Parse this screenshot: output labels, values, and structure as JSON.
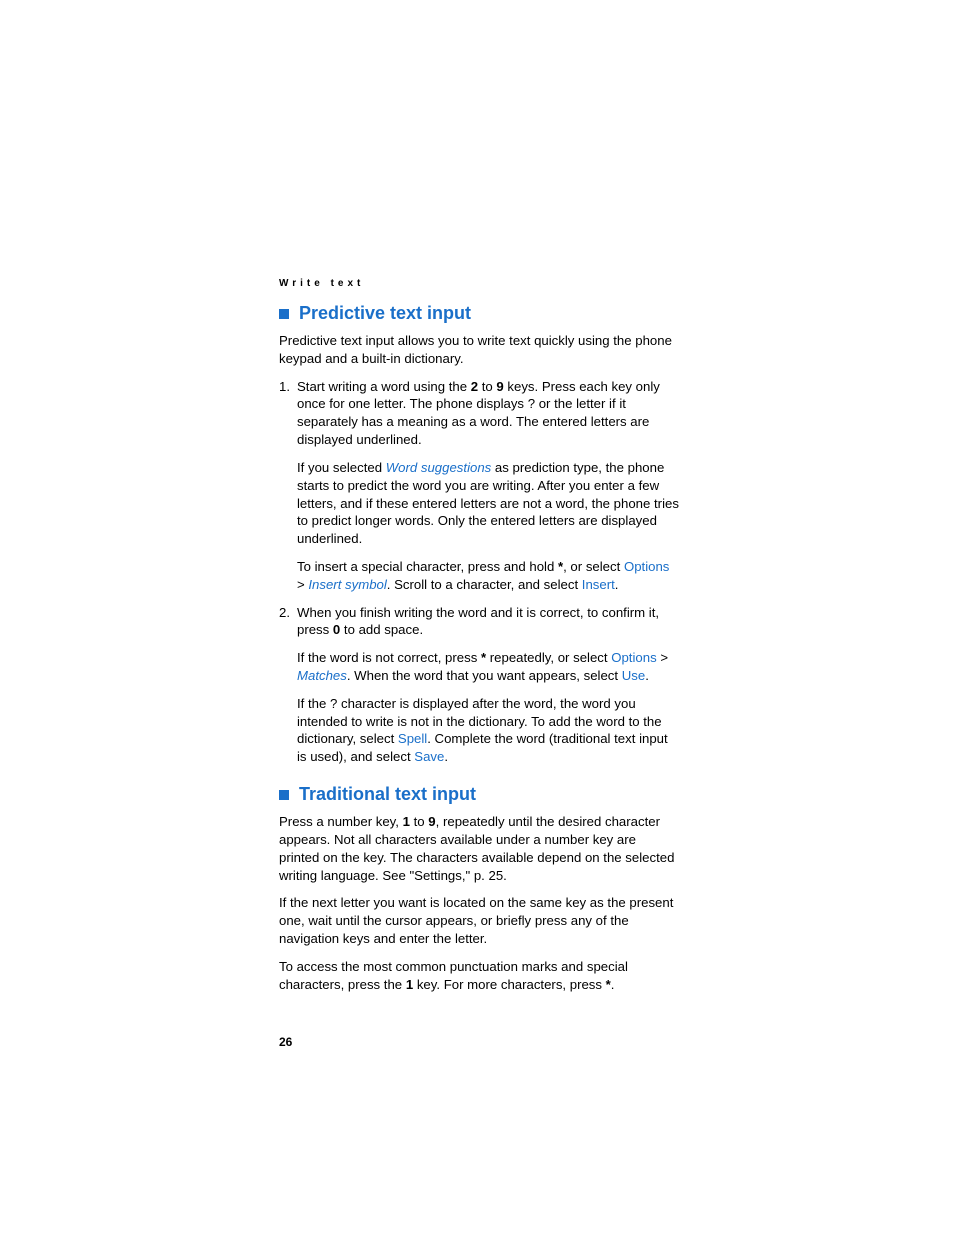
{
  "header": "Write text",
  "section1": {
    "heading": "Predictive text input",
    "intro": "Predictive text input allows you to write text quickly using the phone keypad and a built-in dictionary.",
    "step1_a": "Start writing a word using the ",
    "step1_b": " to ",
    "step1_c": " keys. Press each key only once for one letter. The phone displays ? or the letter if it separately has a meaning as a word. The entered letters are displayed underlined.",
    "key2": "2",
    "key9": "9",
    "p1a": "If you selected ",
    "p1_link": "Word suggestions",
    "p1b": " as prediction type, the phone starts to predict the word you are writing. After you enter a few letters, and if these entered letters are not a word, the phone tries to predict longer words. Only the entered letters are displayed underlined.",
    "p2a": "To insert a special character, press and hold ",
    "p2_star": "*",
    "p2b": ", or select ",
    "p2_options": "Options",
    "p2c": " > ",
    "p2_insert_symbol": "Insert symbol",
    "p2d": ". Scroll to a character, and select ",
    "p2_insert": "Insert",
    "p2e": ".",
    "step2_a": "When you finish writing the word and it is correct, to confirm it, press ",
    "step2_key0": "0",
    "step2_b": " to add space.",
    "p3a": "If the word is not correct, press ",
    "p3_star": "*",
    "p3b": " repeatedly, or select ",
    "p3_options": "Options",
    "p3c": " > ",
    "p3_matches": "Matches",
    "p3d": ". When the word that you want appears, select ",
    "p3_use": "Use",
    "p3e": ".",
    "p4a": "If the ? character is displayed after the word, the word you intended to write is not in the dictionary. To add the word to the dictionary, select ",
    "p4_spell": "Spell",
    "p4b": ". Complete the word (traditional text input is used), and select ",
    "p4_save": "Save",
    "p4c": "."
  },
  "section2": {
    "heading": "Traditional text input",
    "p1a": "Press a number key, ",
    "p1_key1": "1",
    "p1b": " to ",
    "p1_key9": "9",
    "p1c": ", repeatedly until the desired character appears. Not all characters available under a number key are printed on the key. The characters available depend on the selected writing language. See \"Settings,\" p. 25.",
    "p2": "If the next letter you want is located on the same key as the present one, wait until the cursor appears, or briefly press any of the navigation keys and enter the letter.",
    "p3a": "To access the most common punctuation marks and special characters, press the ",
    "p3_key1": "1",
    "p3b": " key. For more characters, press ",
    "p3_star": "*",
    "p3c": "."
  },
  "page_number": "26"
}
